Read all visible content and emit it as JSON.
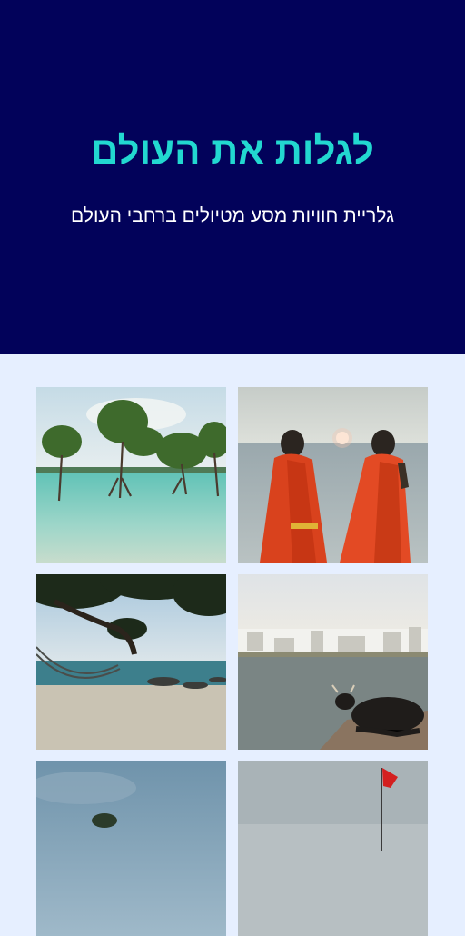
{
  "hero": {
    "title": "לגלות את העולם",
    "subtitle": "גלריית חוויות מסע מטיולים ברחבי העולם",
    "background_color": "#02025a",
    "title_color": "#22d8d0"
  },
  "gallery": {
    "background_color": "#e6efff",
    "images": [
      {
        "subject": "two women in red saris watching sunset over the sea"
      },
      {
        "subject": "mangrove trees standing in turquoise shallow water"
      },
      {
        "subject": "black cow resting by a lake with white town behind"
      },
      {
        "subject": "hammock under a tree on a beach"
      },
      {
        "subject": "red flag on a pole by the sea"
      },
      {
        "subject": "cloudy sky over a wooded shore"
      }
    ]
  }
}
